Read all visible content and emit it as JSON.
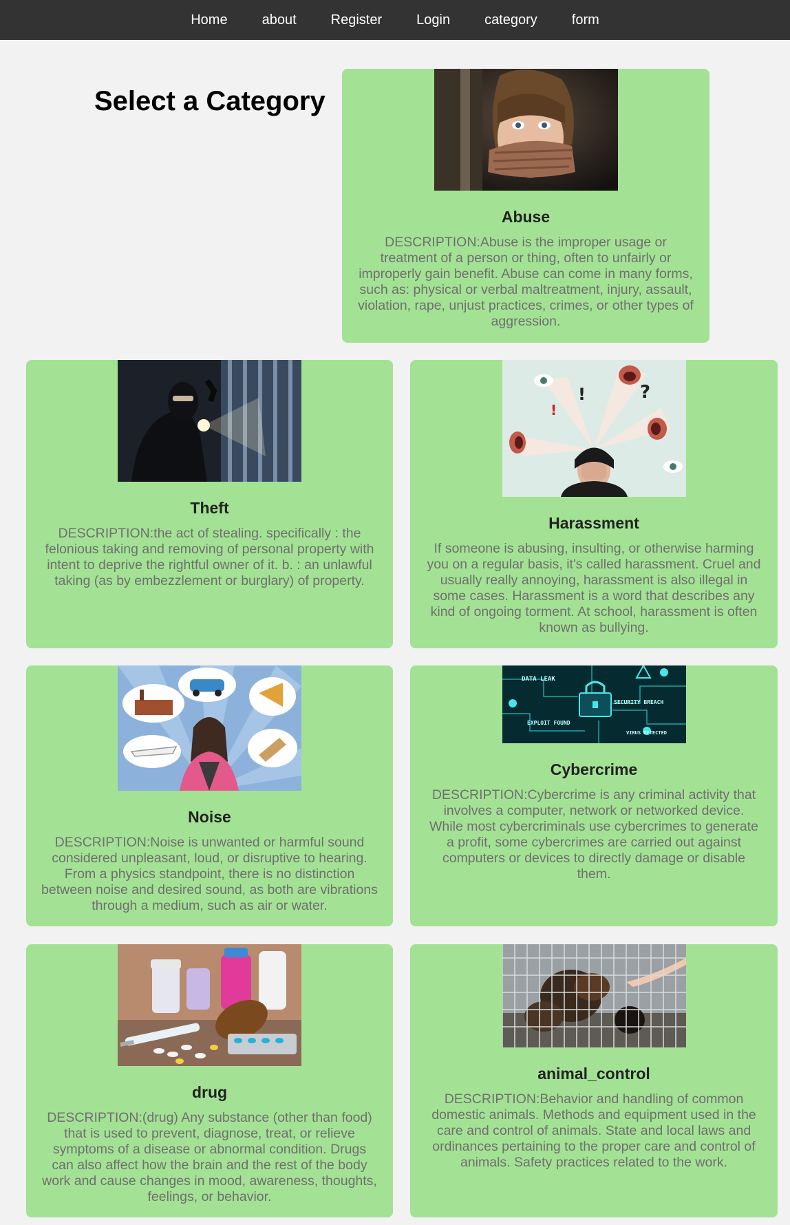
{
  "nav": {
    "items": [
      "Home",
      "about",
      "Register",
      "Login",
      "category",
      "form"
    ]
  },
  "page_title": "Select a Category",
  "categories": [
    {
      "name": "Abuse",
      "description": "DESCRIPTION:Abuse is the improper usage or treatment of a person or thing, often to unfairly or improperly gain benefit. Abuse can come in many forms, such as: physical or verbal maltreatment, injury, assault, violation, rape, unjust practices, crimes, or other types of aggression.",
      "image": "frightened-child-mouth-covered-photo"
    },
    {
      "name": "Theft",
      "description": "DESCRIPTION:the act of stealing. specifically : the felonious taking and removing of personal property with intent to deprive the rightful owner of it. b. : an unlawful taking (as by embezzlement or burglary) of property.",
      "image": "masked-burglar-with-flashlight-photo"
    },
    {
      "name": "Harassment",
      "description": "If someone is abusing, insulting, or otherwise harming you on a regular basis, it's called harassment. Cruel and usually really annoying, harassment is also illegal in some cases. Harassment is a word that describes any kind of ongoing torment. At school, harassment is often known as bullying.",
      "image": "person-covering-face-surrounded-by-mouths-illustration"
    },
    {
      "name": "Noise",
      "description": "DESCRIPTION:Noise is unwanted or harmful sound considered unpleasant, loud, or disruptive to hearing. From a physics standpoint, there is no distinction between noise and desired sound, as both are vibrations through a medium, such as air or water.",
      "image": "woman-covering-ears-noise-sources-illustration"
    },
    {
      "name": "Cybercrime",
      "description": "DESCRIPTION:Cybercrime is any criminal activity that involves a computer, network or networked device. While most cybercriminals use cybercrimes to generate a profit, some cybercrimes are carried out against computers or devices to directly damage or disable them.",
      "image": "circuit-board-security-breach-graphic",
      "image_text": [
        "DATA LEAK",
        "SECURITY BREACH",
        "EXPLOIT FOUND",
        "VIRUS DETECTED"
      ]
    },
    {
      "name": "drug",
      "description": "DESCRIPTION:(drug) Any substance (other than food) that is used to prevent, diagnose, treat, or relieve symptoms of a disease or abnormal condition. Drugs can also affect how the brain and the rest of the body work and cause changes in mood, awareness, thoughts, feelings, or behavior.",
      "image": "pills-syringe-medicine-bottles-photo"
    },
    {
      "name": "animal_control",
      "description": "DESCRIPTION:Behavior and handling of common domestic animals. Methods and equipment used in the care and control of animals. State and local laws and ordinances pertaining to the proper care and control of animals. Safety practices related to the work.",
      "image": "dogs-behind-cage-fence-photo"
    }
  ],
  "colors": {
    "nav_bg": "#333333",
    "card_bg": "#a3e294",
    "page_bg": "#f2f2f2",
    "desc_text": "#6f6f6f"
  }
}
